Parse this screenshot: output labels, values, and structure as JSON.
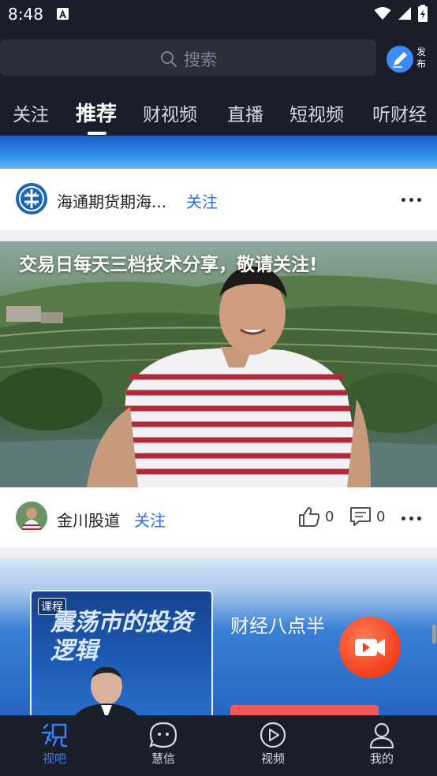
{
  "status_bar": {
    "time": "8:48"
  },
  "header": {
    "search_placeholder": "搜索",
    "publish_label": "发布"
  },
  "tabs": [
    {
      "label": "关注"
    },
    {
      "label": "推荐"
    },
    {
      "label": "财视频"
    },
    {
      "label": "直播"
    },
    {
      "label": "短视频"
    },
    {
      "label": "听财经"
    }
  ],
  "active_tab": "推荐",
  "feed": {
    "card1": {
      "author": "海通期货期海...",
      "follow": "关注"
    },
    "card2": {
      "caption": "交易日每天三档技术分享，敬请关注!",
      "author": "金川股道",
      "follow": "关注",
      "likes": "0",
      "comments": "0"
    },
    "card3": {
      "tag": "课程",
      "course_title": "震荡市的投资逻辑",
      "title": "财经八点半"
    }
  },
  "bottom_nav": [
    {
      "label": "视吧"
    },
    {
      "label": "慧信"
    },
    {
      "label": "视频"
    },
    {
      "label": "我的"
    }
  ],
  "colors": {
    "accent": "#3a7ef2",
    "follow_link": "#2f6ee6",
    "background": "#1a1d2a",
    "live_button": "#f23f1d"
  }
}
